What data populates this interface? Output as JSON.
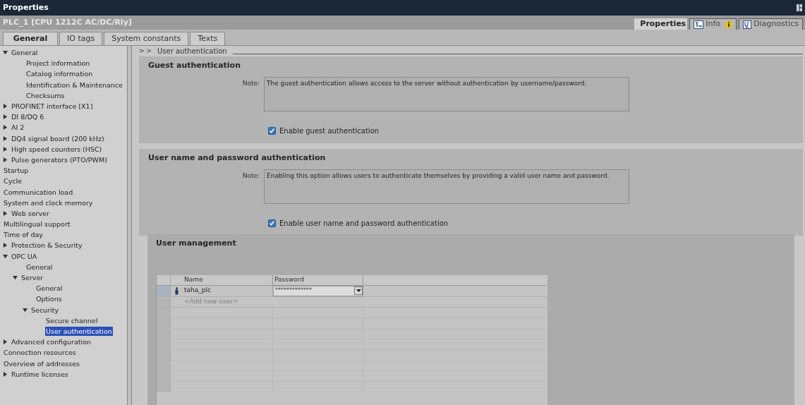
{
  "window": {
    "title": "Properties"
  },
  "device": "PLC_1 [CPU 1212C AC/DC/Rly]",
  "view_tabs": [
    {
      "label": "Properties",
      "selected": true,
      "kind": "properties"
    },
    {
      "label": "Info",
      "selected": false,
      "kind": "info"
    },
    {
      "label": "Diagnostics",
      "selected": false,
      "kind": "diagnostics"
    }
  ],
  "tabs": [
    {
      "label": "General",
      "selected": true
    },
    {
      "label": "IO tags",
      "selected": false
    },
    {
      "label": "System constants",
      "selected": false
    },
    {
      "label": "Texts",
      "selected": false
    }
  ],
  "tree": [
    {
      "label": "General",
      "kind": "node",
      "expanded": true,
      "selected": false,
      "children": [
        {
          "label": "Project information",
          "kind": "leaf",
          "selected": false
        },
        {
          "label": "Catalog information",
          "kind": "leaf",
          "selected": false
        },
        {
          "label": "Identification & Maintenance",
          "kind": "leaf",
          "selected": false
        },
        {
          "label": "Checksums",
          "kind": "leaf",
          "selected": false
        }
      ]
    },
    {
      "label": "PROFINET interface [X1]",
      "kind": "node",
      "expanded": false,
      "selected": false
    },
    {
      "label": "DI 8/DQ 6",
      "kind": "node",
      "expanded": false,
      "selected": false
    },
    {
      "label": "AI 2",
      "kind": "node",
      "expanded": false,
      "selected": false
    },
    {
      "label": "DQ4 signal board (200 kHz)",
      "kind": "node",
      "expanded": false,
      "selected": false
    },
    {
      "label": "High speed counters (HSC)",
      "kind": "node",
      "expanded": false,
      "selected": false
    },
    {
      "label": "Pulse generators (PTO/PWM)",
      "kind": "node",
      "expanded": false,
      "selected": false
    },
    {
      "label": "Startup",
      "kind": "leaf",
      "selected": false
    },
    {
      "label": "Cycle",
      "kind": "leaf",
      "selected": false
    },
    {
      "label": "Communication load",
      "kind": "leaf",
      "selected": false
    },
    {
      "label": "System and clock memory",
      "kind": "leaf",
      "selected": false
    },
    {
      "label": "Web server",
      "kind": "node",
      "expanded": false,
      "selected": false
    },
    {
      "label": "Multilingual support",
      "kind": "leaf",
      "selected": false
    },
    {
      "label": "Time of day",
      "kind": "leaf",
      "selected": false
    },
    {
      "label": "Protection & Security",
      "kind": "node",
      "expanded": false,
      "selected": false
    },
    {
      "label": "OPC UA",
      "kind": "node",
      "expanded": true,
      "selected": false,
      "children": [
        {
          "label": "General",
          "kind": "leaf",
          "selected": false
        },
        {
          "label": "Server",
          "kind": "node",
          "expanded": true,
          "selected": false,
          "children": [
            {
              "label": "General",
              "kind": "leaf",
              "selected": false
            },
            {
              "label": "Options",
              "kind": "leaf",
              "selected": false
            },
            {
              "label": "Security",
              "kind": "node",
              "expanded": true,
              "selected": false,
              "children": [
                {
                  "label": "Secure channel",
                  "kind": "leaf",
                  "selected": false
                },
                {
                  "label": "User authentication",
                  "kind": "leaf",
                  "selected": true
                }
              ]
            }
          ]
        }
      ]
    },
    {
      "label": "Advanced configuration",
      "kind": "node",
      "expanded": false,
      "selected": false
    },
    {
      "label": "Connection resources",
      "kind": "leaf",
      "selected": false
    },
    {
      "label": "Overview of addresses",
      "kind": "leaf",
      "selected": false
    },
    {
      "label": "Runtime licenses",
      "kind": "node",
      "expanded": false,
      "selected": false
    }
  ],
  "breadcrumb": {
    "arrows": "> >",
    "title": "User authentication"
  },
  "sections": [
    {
      "title": "Guest authentication",
      "note_label": "Note:",
      "note": "The guest authentication allows access to the server without authentication by username/password.",
      "checkbox": {
        "label": "Enable guest authentication",
        "checked": true
      }
    },
    {
      "title": "User name and password authentication",
      "note_label": "Note:",
      "note": "Enabling this option allows users to authenticate themselves by providing a valid user name and password.",
      "checkbox": {
        "label": "Enable user name and password authentication",
        "checked": true
      }
    }
  ],
  "user_management": {
    "title": "User management",
    "columns": [
      "Name",
      "Password"
    ],
    "rows": [
      {
        "name": "taha_plc",
        "password": "*************"
      }
    ],
    "add_row": "<Add new user>"
  }
}
